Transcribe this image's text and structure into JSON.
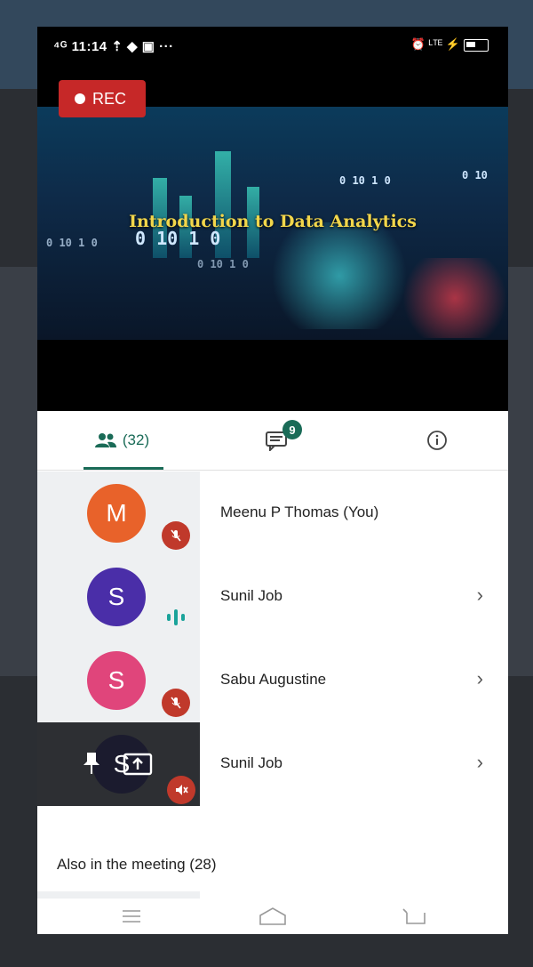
{
  "status_bar": {
    "time": "11:14",
    "battery": "30"
  },
  "recording": {
    "label": "REC"
  },
  "video": {
    "title": "Introduction to Data Analytics"
  },
  "tabs": {
    "people_count": "(32)",
    "chat_badge": "9"
  },
  "participants": [
    {
      "initial": "M",
      "name": "Meenu P Thomas (You)",
      "color": "#e8622a",
      "mic": "muted"
    },
    {
      "initial": "S",
      "name": "Sunil Job",
      "color": "#4a2ea8",
      "mic": "speaking"
    },
    {
      "initial": "S",
      "name": "Sabu Augustine",
      "color": "#e0457b",
      "mic": "muted"
    },
    {
      "initial": "S",
      "name": "Sunil Job",
      "color": "#1b1b2e",
      "mic": "muted",
      "presenting": true
    }
  ],
  "also_in_meeting": "Also in the meeting (28)",
  "colors": {
    "accent": "#1a6b57",
    "rec": "#c62828",
    "mute": "#c0392b"
  }
}
